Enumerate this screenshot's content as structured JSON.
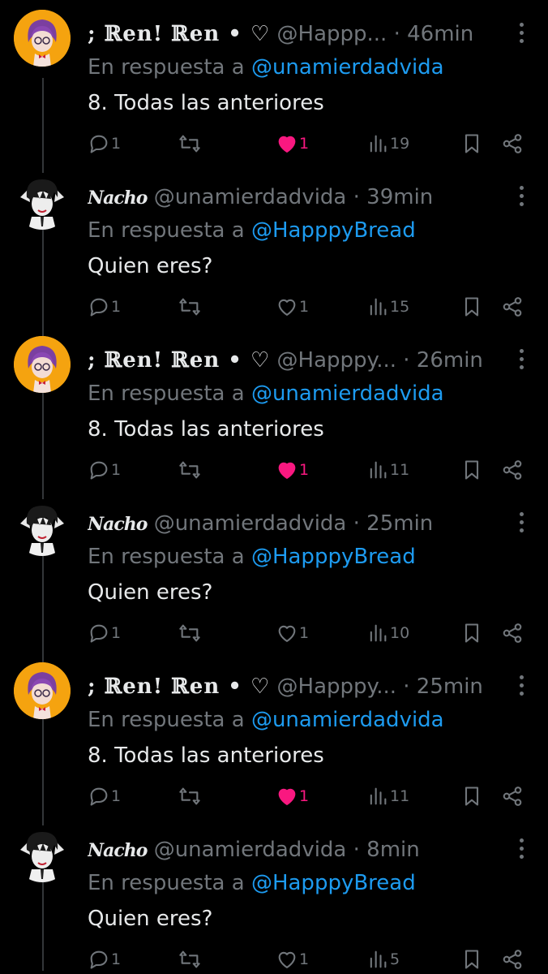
{
  "colors": {
    "background": "#000000",
    "text": "#e7e9ea",
    "muted": "#71767b",
    "link": "#1d9bf0",
    "like": "#f91880",
    "ren_avatar_bg": "#f5a30f"
  },
  "icons": {
    "reply": "reply-icon",
    "retweet": "retweet-icon",
    "like": "heart-icon",
    "views": "views-icon",
    "bookmark": "bookmark-icon",
    "share": "share-icon",
    "more": "more-icon"
  },
  "tweets": [
    {
      "author": "ren",
      "name": "; ℝen! ℝen • ♡",
      "handle": "@Happp...",
      "sep": "·",
      "time": "46min",
      "reply_prefix": "En respuesta a",
      "reply_to": "@unamierdadvida",
      "text": "8. Todas las anteriores",
      "replies": "1",
      "retweets": "",
      "likes": "1",
      "liked": true,
      "views": "19"
    },
    {
      "author": "nacho",
      "name": "Nacho",
      "handle": "@unamierdadvida",
      "sep": "·",
      "time": "39min",
      "reply_prefix": "En respuesta a",
      "reply_to": "@HapppyBread",
      "text": "Quien eres?",
      "replies": "1",
      "retweets": "",
      "likes": "1",
      "liked": false,
      "views": "15"
    },
    {
      "author": "ren",
      "name": "; ℝen! ℝen • ♡",
      "handle": "@Happpy...",
      "sep": "·",
      "time": "26min",
      "reply_prefix": "En respuesta a",
      "reply_to": "@unamierdadvida",
      "text": "8. Todas las anteriores",
      "replies": "1",
      "retweets": "",
      "likes": "1",
      "liked": true,
      "views": "11"
    },
    {
      "author": "nacho",
      "name": "Nacho",
      "handle": "@unamierdadvida",
      "sep": "·",
      "time": "25min",
      "reply_prefix": "En respuesta a",
      "reply_to": "@HapppyBread",
      "text": "Quien eres?",
      "replies": "1",
      "retweets": "",
      "likes": "1",
      "liked": false,
      "views": "10"
    },
    {
      "author": "ren",
      "name": "; ℝen! ℝen • ♡",
      "handle": "@Happpy...",
      "sep": "·",
      "time": "25min",
      "reply_prefix": "En respuesta a",
      "reply_to": "@unamierdadvida",
      "text": "8. Todas las anteriores",
      "replies": "1",
      "retweets": "",
      "likes": "1",
      "liked": true,
      "views": "11"
    },
    {
      "author": "nacho",
      "name": "Nacho",
      "handle": "@unamierdadvida",
      "sep": "·",
      "time": "8min",
      "reply_prefix": "En respuesta a",
      "reply_to": "@HapppyBread",
      "text": "Quien eres?",
      "replies": "1",
      "retweets": "",
      "likes": "1",
      "liked": false,
      "views": "5"
    }
  ]
}
